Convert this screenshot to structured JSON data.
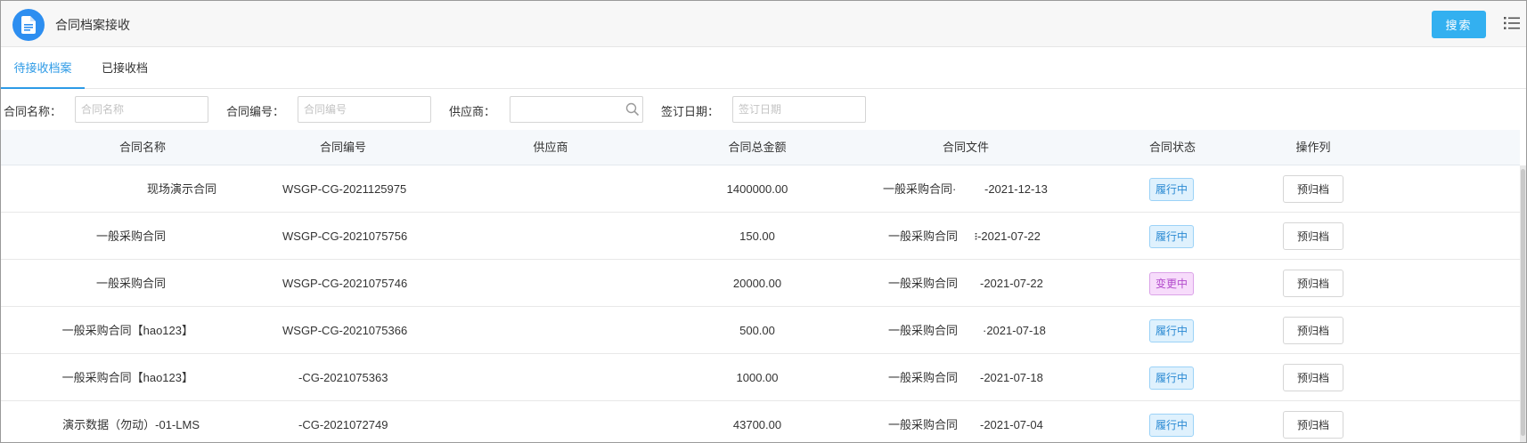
{
  "header": {
    "app_icon": "document-icon",
    "title": "合同档案接收",
    "search_label": "搜索",
    "menu_icon": "list-menu-icon"
  },
  "tabs": [
    {
      "label": "待接收档案",
      "active": true
    },
    {
      "label": "已接收档案",
      "active": false
    }
  ],
  "filters": {
    "contract_name": {
      "label": "合同名称：",
      "placeholder": "合同名称",
      "value": ""
    },
    "contract_code": {
      "label": "合同编号：",
      "placeholder": "合同编号",
      "value": ""
    },
    "supplier": {
      "label": "供应商：",
      "placeholder": "",
      "value": "",
      "icon": "search-icon"
    },
    "sign_date": {
      "label": "签订日期：",
      "placeholder": "签订日期",
      "value": ""
    }
  },
  "table": {
    "columns": [
      "合同名称",
      "合同编号",
      "供应商",
      "合同总金额",
      "合同文件",
      "合同状态",
      "操作列"
    ],
    "rows": [
      {
        "name": "现场演示合同",
        "code": "WSGP-CG-2021125975",
        "supplier": "",
        "amount": "1400000.00",
        "file_name": "一般采购合同·",
        "file_date": "-2021-12-13",
        "status": "履行中",
        "status_type": "exec",
        "action": "预归档"
      },
      {
        "name": "一般采购合同",
        "code": "WSGP-CG-2021075756",
        "supplier": "",
        "amount": "150.00",
        "file_name": "一般采购合同",
        "file_date": "፧-2021-07-22",
        "status": "履行中",
        "status_type": "exec",
        "action": "预归档"
      },
      {
        "name": "一般采购合同",
        "code": "WSGP-CG-2021075746",
        "supplier": "",
        "amount": "20000.00",
        "file_name": "一般采购合同",
        "file_date": "-2021-07-22",
        "status": "变更中",
        "status_type": "change",
        "action": "预归档"
      },
      {
        "name": "一般采购合同【hao123】",
        "code": "WSGP-CG-2021075366",
        "supplier": "",
        "amount": "500.00",
        "file_name": "一般采购合同",
        "file_date": "·2021-07-18",
        "status": "履行中",
        "status_type": "exec",
        "action": "预归档"
      },
      {
        "name": "一般采购合同【hao123】",
        "code": "-CG-2021075363",
        "supplier": "",
        "amount": "1000.00",
        "file_name": "一般采购合同",
        "file_date": "-2021-07-18",
        "status": "履行中",
        "status_type": "exec",
        "action": "预归档"
      },
      {
        "name": "演示数据（勿动）-01-LMS",
        "code": "-CG-2021072749",
        "supplier": "",
        "amount": "43700.00",
        "file_name": "一般采购合同",
        "file_date": "-2021-07-04",
        "status": "履行中",
        "status_type": "exec",
        "action": "预归档"
      }
    ]
  },
  "colors": {
    "accent": "#2d9ae6",
    "search_button": "#33b0f0",
    "status_exec": "#2b8ad3",
    "status_change": "#b34bcc"
  }
}
